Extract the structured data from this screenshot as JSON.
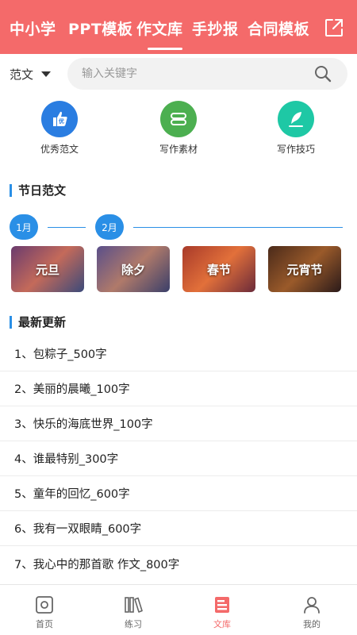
{
  "header": {
    "tabs": [
      {
        "label": "中小学"
      },
      {
        "label": "PPT模板"
      },
      {
        "label": "作文库",
        "active": true
      },
      {
        "label": "手抄报"
      },
      {
        "label": "合同模板"
      }
    ],
    "share_icon": "external-link-icon",
    "background_color": "#f46a6a"
  },
  "search": {
    "category": "范文",
    "placeholder": "输入关键字",
    "icon": "search-icon"
  },
  "features": [
    {
      "label": "优秀范文",
      "icon": "thumbs-up-icon",
      "color": "#2a7de1",
      "badge": "优"
    },
    {
      "label": "写作素材",
      "icon": "material-icon",
      "color": "#4caf50"
    },
    {
      "label": "写作技巧",
      "icon": "quill-icon",
      "color": "#1ec8a5"
    }
  ],
  "holidays": {
    "title": "节日范文",
    "months": [
      "1月",
      "2月"
    ],
    "cards": [
      {
        "label": "元旦"
      },
      {
        "label": "除夕"
      },
      {
        "label": "春节"
      },
      {
        "label": "元宵节"
      }
    ]
  },
  "latest": {
    "title": "最新更新",
    "items": [
      "1、包粽子_500字",
      "2、美丽的晨曦_100字",
      "3、快乐的海底世界_100字",
      "4、谁最特别_300字",
      "5、童年的回忆_600字",
      "6、我有一双眼睛_600字",
      "7、我心中的那首歌 作文_800字"
    ]
  },
  "bottom_nav": {
    "items": [
      {
        "label": "首页",
        "icon": "home-icon"
      },
      {
        "label": "练习",
        "icon": "books-icon"
      },
      {
        "label": "文库",
        "icon": "library-icon",
        "active": true
      },
      {
        "label": "我的",
        "icon": "user-icon"
      }
    ],
    "active_color": "#f46a6a"
  },
  "accent_color": "#2a8fe6"
}
